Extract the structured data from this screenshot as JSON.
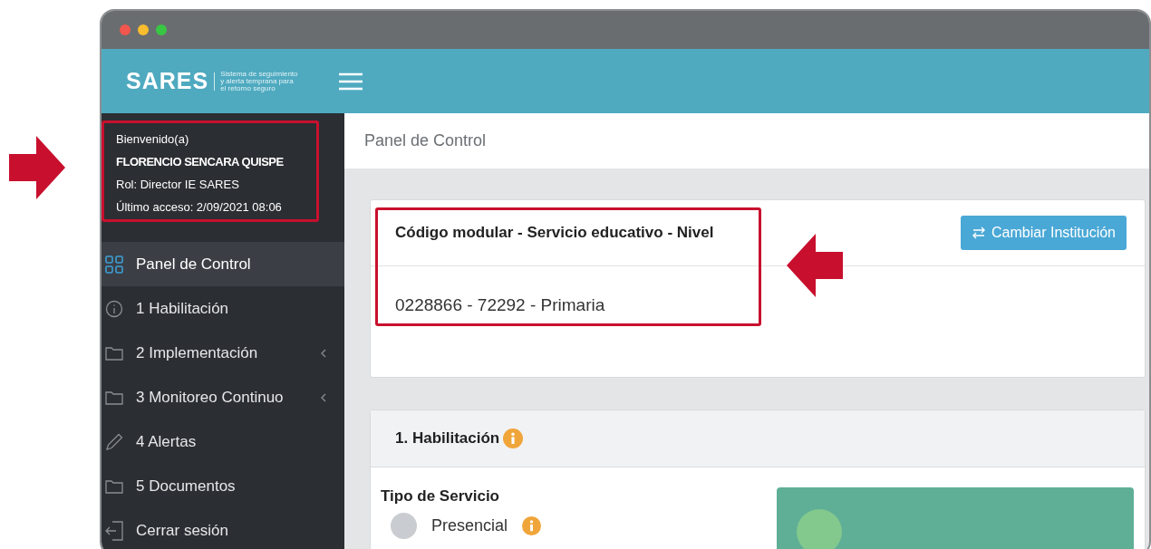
{
  "brand": {
    "name": "SARES",
    "tagline": [
      "Sistema de seguimiento",
      "y alerta temprana para",
      "el retorno seguro"
    ]
  },
  "user": {
    "greeting": "Bienvenido(a)",
    "name": "FLORENCIO SENCARA QUISPE",
    "role": "Rol: Director IE SARES",
    "last_access": "Último acceso: 2/09/2021 08:06",
    "highlighted": true
  },
  "sidebar": {
    "items": [
      {
        "label": "Panel de Control",
        "kind": "grid",
        "selected": true,
        "has_submenu": false
      },
      {
        "label": "1 Habilitación",
        "kind": "info",
        "selected": false,
        "has_submenu": false
      },
      {
        "label": "2 Implementación",
        "kind": "folder",
        "selected": false,
        "has_submenu": true
      },
      {
        "label": "3 Monitoreo Continuo",
        "kind": "folder",
        "selected": false,
        "has_submenu": true
      },
      {
        "label": "4 Alertas",
        "kind": "pencil",
        "selected": false,
        "has_submenu": false
      },
      {
        "label": "5 Documentos",
        "kind": "folder",
        "selected": false,
        "has_submenu": false
      },
      {
        "label": "Cerrar sesión",
        "kind": "logout",
        "selected": false,
        "has_submenu": false
      }
    ]
  },
  "breadcrumb": "Panel de Control",
  "institution_card": {
    "heading": "Código modular - Servicio educativo - Nivel",
    "button": "Cambiar Institución",
    "value": "0228866 - 72292 - Primaria",
    "highlighted": true
  },
  "habilitacion_card": {
    "title": "1. Habilitación",
    "field_label": "Tipo de Servicio",
    "options": [
      {
        "label": "Presencial",
        "selected": false
      }
    ]
  },
  "arrows": [
    {
      "kind": "right"
    },
    {
      "kind": "left"
    }
  ]
}
